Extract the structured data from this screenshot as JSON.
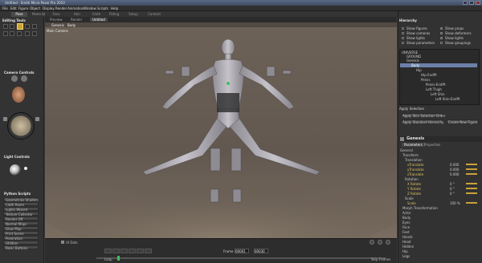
{
  "window": {
    "title": "Untitled - Smith Micro Poser Pro 2010"
  },
  "menu": [
    "File",
    "Edit",
    "Figure",
    "Object",
    "Display",
    "Render",
    "Animation",
    "Window",
    "Scripts",
    "Help"
  ],
  "room_tabs": [
    "Pose",
    "Material",
    "Face",
    "Hair",
    "Cloth",
    "Fitting",
    "Setup",
    "Content"
  ],
  "left": {
    "editing_tools": "Editing Tools",
    "camera_controls": "Camera Controls",
    "light_controls": "Light Controls",
    "python_scripts": "Python Scripts",
    "script_buttons": [
      "Geometries Shaders",
      "Cloth Room",
      "Lights Wizard",
      "Texture Collector",
      "Render Off",
      "Normal Maps",
      "Glow Map",
      "Print Scene",
      "Poseration",
      "Utilities",
      "Basic Buttons"
    ]
  },
  "viewport": {
    "tabs": [
      "Preview",
      "Render",
      "Untitled"
    ],
    "figure_select": "Genesis",
    "part_select": "Body",
    "camera_label": "Main Camera",
    "frame_label": "Frame",
    "frame_current": "00001",
    "frame_total": "00030",
    "loop_label": "Loop",
    "skip_frames": "Skip Frames",
    "layer_label": "UI Dots"
  },
  "hierarchy": {
    "title": "Hierarchy",
    "options": [
      "Show figures",
      "Show cameras",
      "Show lights",
      "Show parameters",
      "Show props",
      "Show deformers",
      "Show lights",
      "Show groupings"
    ],
    "items": [
      "UNIVERSE",
      "GROUND",
      "Genesis",
      "Body",
      "Hip",
      "Hip-EndPt",
      "Pelvis",
      "Pelvis-EndPt",
      "Left Thigh",
      "Left Shin",
      "Left Shin-EndPt"
    ]
  },
  "apply_selection": {
    "title": "Apply Selection",
    "buttons": [
      "Apply Skin Selection Order",
      "Apply Standard Hierarchy",
      "Create New Figure"
    ]
  },
  "params": {
    "figure_name": "Genesis",
    "tabs": [
      "Parameters",
      "Properties"
    ],
    "groups": [
      "General",
      "Transform",
      "Translation",
      "Rotation",
      "Scale",
      "Morph Transformation",
      "Actor",
      "Body",
      "Eyes",
      "Face",
      "Feet",
      "Hands",
      "Head",
      "Hidden",
      "Hip",
      "Legs"
    ],
    "rows": [
      {
        "label": "xTranslate",
        "value": "0.000"
      },
      {
        "label": "yTranslate",
        "value": "0.000"
      },
      {
        "label": "zTranslate",
        "value": "0.000"
      },
      {
        "label": "X Rotate",
        "value": "0 °"
      },
      {
        "label": "Y Rotate",
        "value": "0 °"
      },
      {
        "label": "Z Rotate",
        "value": "0 °"
      },
      {
        "label": "Scale",
        "value": "100 %"
      }
    ]
  },
  "colors": {
    "accent": "#c9a23a",
    "selection": "#6b7fa8",
    "viewport": "#665c53"
  }
}
